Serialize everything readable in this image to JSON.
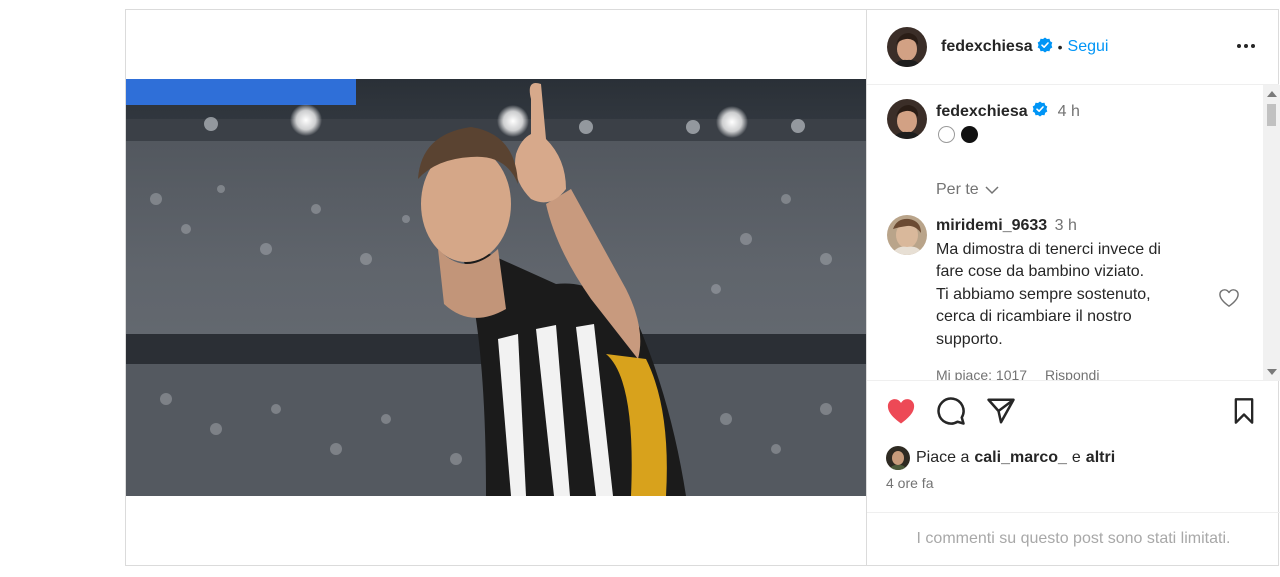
{
  "header": {
    "username": "fedexchiesa",
    "separator": "•",
    "follow_label": "Segui",
    "more_icon": "more-horizontal-icon"
  },
  "caption": {
    "username": "fedexchiesa",
    "time": "4 h",
    "emoji": "⚪⚫"
  },
  "filter": {
    "label": "Per te"
  },
  "comment": {
    "username": "miridemi_9633",
    "time": "3 h",
    "lines": [
      "Ma dimostra di tenerci invece di",
      "fare cose da bambino viziato.",
      "Ti abbiamo sempre sostenuto,",
      "cerca di ricambiare il nostro",
      "supporto."
    ],
    "likes": "Mi piace: 1017",
    "reply": "Rispondi"
  },
  "likes": {
    "prefix": "Piace a",
    "user": "cali_marco_",
    "middle": "e",
    "others": "altri"
  },
  "timestamp": "4 ore fa",
  "comments_limited": "I commenti su questo post sono stati limitati.",
  "colors": {
    "like_red": "#ed4956",
    "verified_blue": "#0095f6",
    "link_blue": "#0095f6",
    "muted": "#737373"
  }
}
